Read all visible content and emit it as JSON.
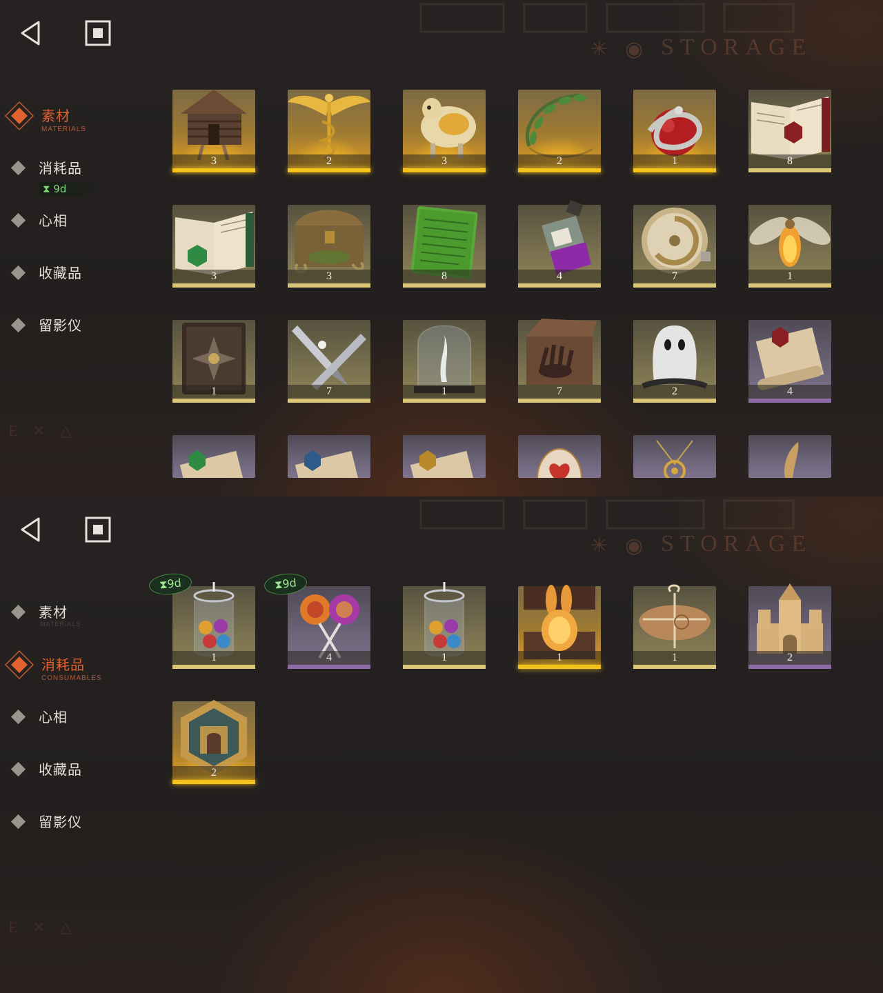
{
  "watermark": {
    "title": "STORAGE"
  },
  "badge_time": "9d",
  "panels": [
    {
      "active_category": "materials",
      "categories": [
        {
          "id": "materials",
          "label": "素材",
          "sub": "MATERIALS"
        },
        {
          "id": "consumables",
          "label": "消耗品",
          "sub": ""
        },
        {
          "id": "mind",
          "label": "心相",
          "sub": ""
        },
        {
          "id": "collectibles",
          "label": "收藏品",
          "sub": ""
        },
        {
          "id": "projector",
          "label": "留影仪",
          "sub": ""
        }
      ],
      "sidebar_timer": "9d",
      "items": [
        {
          "icon": "chicken-leg-hut-icon",
          "count": "3",
          "rarity": "gold"
        },
        {
          "icon": "caduceus-icon",
          "count": "2",
          "rarity": "gold"
        },
        {
          "icon": "golden-sheep-icon",
          "count": "3",
          "rarity": "gold"
        },
        {
          "icon": "laurel-wreath-icon",
          "count": "2",
          "rarity": "gold"
        },
        {
          "icon": "snake-apple-icon",
          "count": "1",
          "rarity": "gold"
        },
        {
          "icon": "red-tome-icon",
          "count": "8",
          "rarity": "tan"
        },
        {
          "icon": "green-tome-icon",
          "count": "3",
          "rarity": "tan"
        },
        {
          "icon": "mossy-chest-icon",
          "count": "3",
          "rarity": "tan"
        },
        {
          "icon": "green-tablet-icon",
          "count": "8",
          "rarity": "tan"
        },
        {
          "icon": "potion-bottle-icon",
          "count": "4",
          "rarity": "tan"
        },
        {
          "icon": "brass-dial-icon",
          "count": "7",
          "rarity": "tan"
        },
        {
          "icon": "glowing-moth-icon",
          "count": "1",
          "rarity": "tan"
        },
        {
          "icon": "dark-grimoire-icon",
          "count": "1",
          "rarity": "tan"
        },
        {
          "icon": "bullet-pair-icon",
          "count": "7",
          "rarity": "tan"
        },
        {
          "icon": "bell-jar-icon",
          "count": "1",
          "rarity": "tan"
        },
        {
          "icon": "hand-box-icon",
          "count": "7",
          "rarity": "tan"
        },
        {
          "icon": "ghost-icon",
          "count": "2",
          "rarity": "tan"
        },
        {
          "icon": "scroll-red-icon",
          "count": "4",
          "rarity": "purple"
        },
        {
          "icon": "scroll-green-icon",
          "count": "",
          "rarity": "purple",
          "cut": true
        },
        {
          "icon": "scroll-blue-icon",
          "count": "",
          "rarity": "purple",
          "cut": true
        },
        {
          "icon": "scroll-gold-icon",
          "count": "",
          "rarity": "purple",
          "cut": true
        },
        {
          "icon": "ornate-egg-icon",
          "count": "",
          "rarity": "purple",
          "cut": true
        },
        {
          "icon": "pendant-icon",
          "count": "",
          "rarity": "purple",
          "cut": true
        },
        {
          "icon": "feather-quill-icon",
          "count": "",
          "rarity": "purple",
          "cut": true
        }
      ]
    },
    {
      "active_category": "consumables",
      "categories": [
        {
          "id": "materials",
          "label": "素材",
          "sub": "MATERIALS"
        },
        {
          "id": "consumables",
          "label": "消耗品",
          "sub": "CONSUMABLES"
        },
        {
          "id": "mind",
          "label": "心相",
          "sub": ""
        },
        {
          "id": "collectibles",
          "label": "收藏品",
          "sub": ""
        },
        {
          "id": "projector",
          "label": "留影仪",
          "sub": ""
        }
      ],
      "items": [
        {
          "icon": "candy-jar-icon",
          "count": "1",
          "rarity": "tan",
          "timer": true
        },
        {
          "icon": "lollipops-icon",
          "count": "4",
          "rarity": "purple",
          "timer": true
        },
        {
          "icon": "candy-jar-icon",
          "count": "1",
          "rarity": "tan"
        },
        {
          "icon": "rabbit-box-icon",
          "count": "1",
          "rarity": "gold"
        },
        {
          "icon": "wrapped-parcel-icon",
          "count": "1",
          "rarity": "tan"
        },
        {
          "icon": "sand-castle-icon",
          "count": "2",
          "rarity": "purple"
        },
        {
          "icon": "puzzle-box-icon",
          "count": "2",
          "rarity": "gold"
        }
      ]
    }
  ]
}
